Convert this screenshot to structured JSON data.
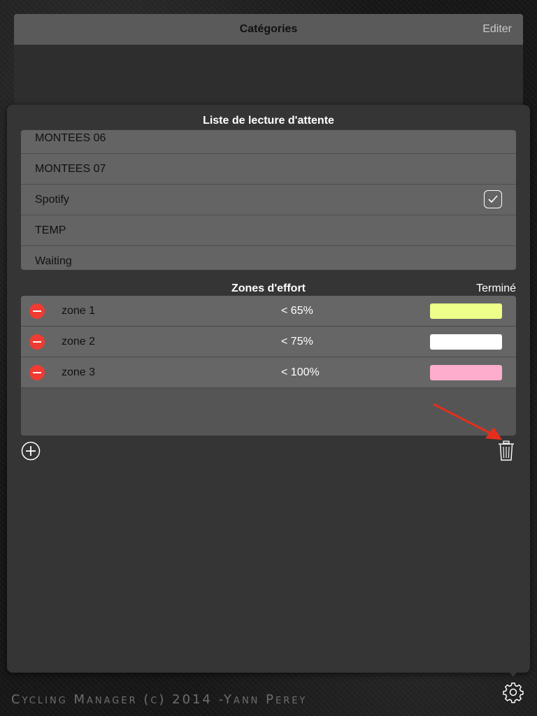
{
  "categories": {
    "title": "Catégories",
    "edit_label": "Editer"
  },
  "playlist_section": {
    "title": "Liste de lecture d'attente",
    "items": [
      {
        "label": "MONTEES 06",
        "checked": false
      },
      {
        "label": "MONTEES 07",
        "checked": false
      },
      {
        "label": "Spotify",
        "checked": true
      },
      {
        "label": "TEMP",
        "checked": false
      },
      {
        "label": "Waiting",
        "checked": false
      }
    ]
  },
  "zones_section": {
    "title": "Zones d'effort",
    "done_label": "Terminé",
    "zones": [
      {
        "name": "zone 1",
        "threshold": "< 65%",
        "color": "#eeff8a"
      },
      {
        "name": "zone 2",
        "threshold": "< 75%",
        "color": "#ffffff"
      },
      {
        "name": "zone 3",
        "threshold": "< 100%",
        "color": "#ffadcd"
      }
    ]
  },
  "toolbar": {
    "add_icon": "plus-circle-icon",
    "delete_icon": "trash-icon"
  },
  "footer": {
    "copyright": "Cycling Manager (c) 2014 -Yann Perey",
    "settings_icon": "gear-icon"
  },
  "colors": {
    "delete_red": "#ef3b32",
    "annotation_arrow": "#e52e1c"
  }
}
